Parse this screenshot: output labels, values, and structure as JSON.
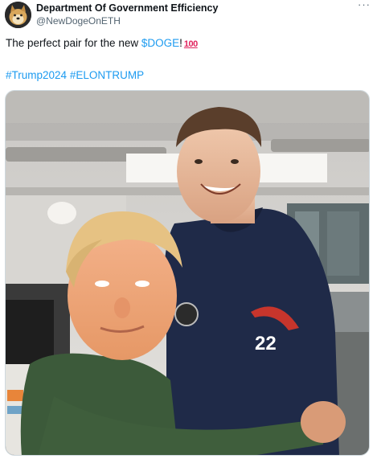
{
  "author": {
    "display_name": "Department Of Government Efficiency",
    "handle": "@NewDogeOnETH",
    "avatar_icon": "doge-avatar-icon"
  },
  "post": {
    "text_before_link": "The perfect pair for the new ",
    "cashtag": "$DOGE",
    "text_after_link": "!",
    "emoji": "100",
    "hashtags": [
      "#Trump2024",
      "#ELONTRUMP"
    ]
  },
  "media": {
    "patch_number": "22",
    "alt": "photo"
  },
  "colors": {
    "link": "#1d9bf0",
    "secondary_text": "#536471",
    "border": "#cfd9de"
  }
}
